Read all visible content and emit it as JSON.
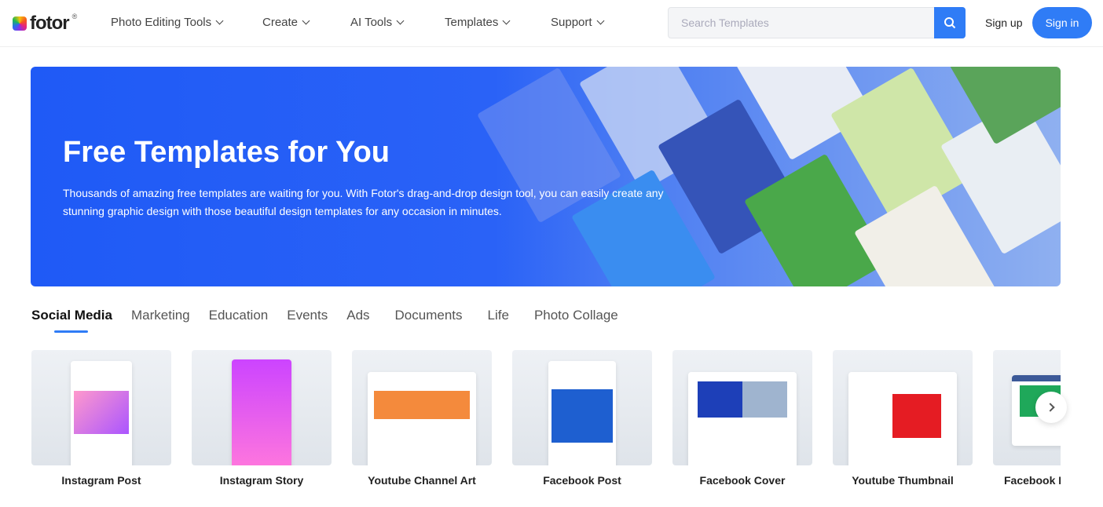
{
  "header": {
    "logo": "fotor",
    "menu": [
      "Photo Editing Tools",
      "Create",
      "AI Tools",
      "Templates",
      "Support"
    ],
    "search_placeholder": "Search Templates",
    "signup": "Sign up",
    "signin": "Sign in"
  },
  "hero": {
    "title": "Free Templates for You",
    "description": "Thousands of amazing free templates are waiting for you. With Fotor's drag-and-drop design tool, you can easily create any stunning graphic design with those beautiful design templates for any occasion in minutes."
  },
  "tabs": [
    "Social Media",
    "Marketing",
    "Education",
    "Events",
    "Ads",
    "Documents",
    "Life",
    "Photo Collage"
  ],
  "cards": [
    "Instagram Post",
    "Instagram Story",
    "Youtube Channel Art",
    "Facebook Post",
    "Facebook Cover",
    "Youtube Thumbnail",
    "Facebook Banner"
  ],
  "colors": {
    "accent": "#2f7cf6",
    "hero": "#1f5af6"
  }
}
